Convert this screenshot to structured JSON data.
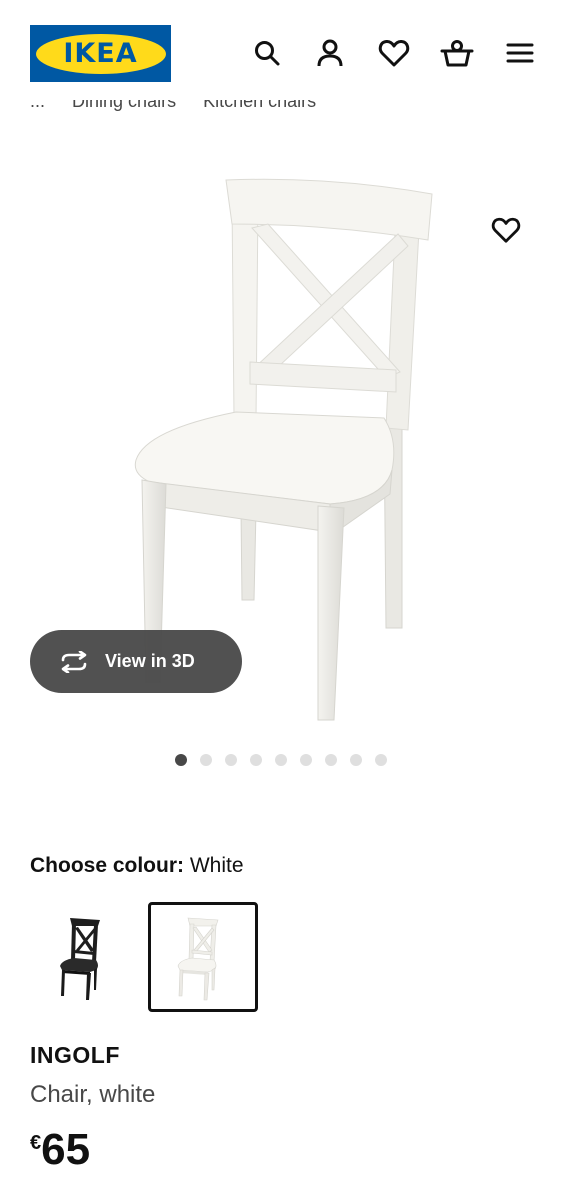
{
  "header": {
    "logo_text": "IKEA",
    "icons": [
      "search-icon",
      "user-icon",
      "heart-icon",
      "basket-icon",
      "menu-icon"
    ]
  },
  "breadcrumb": [
    "...",
    "Dining chairs",
    "Kitchen chairs"
  ],
  "gallery": {
    "view3d_label": "View in 3D",
    "slide_count": 9,
    "active_slide": 1
  },
  "colour": {
    "label": "Choose colour:",
    "value": "White",
    "options": [
      "black-brown",
      "white"
    ],
    "selected": "white"
  },
  "product": {
    "name": "INGOLF",
    "description": "Chair, white",
    "currency": "€",
    "price": "65"
  },
  "colors": {
    "ikea_blue": "#0058a3",
    "ikea_yellow": "#ffda1a",
    "pill_bg": "#484848"
  }
}
